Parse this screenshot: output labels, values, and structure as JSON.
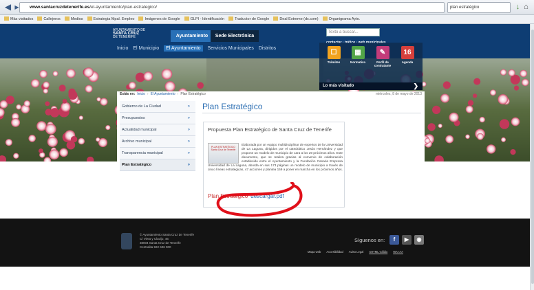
{
  "browser": {
    "url_domain": "www.santacruzdetenerife.es",
    "url_path": "/el-ayuntamiento/plan-estrategico/",
    "search_text": "plan estratégico"
  },
  "bookmarks": [
    "Más visitados",
    "Callejeros",
    "Medios",
    "Estrategia Mpal. Empleo",
    "Imágenes de Google",
    "GLPI - Identificación",
    "Traductor de Google",
    "Deal Extreme (dx.com)",
    "Organigrama Ayto."
  ],
  "site": {
    "logo_line1": "AYUNTAMIENTO DE",
    "logo_line2": "SANTA CRUZ",
    "logo_line3": "DE TENERIFE",
    "tab_ayuntamiento": "Ayuntamiento",
    "tab_sede": "Sede Electrónica",
    "nav": [
      "Inicio",
      "El Municipio",
      "El Ayuntamiento",
      "Servicios Municipales",
      "Distritos"
    ],
    "search_placeholder": "Texto a buscar...",
    "top_links": "contactar  ·  tráfico  ·  web municipales"
  },
  "quick": {
    "items": [
      {
        "label": "Trámites",
        "color": "#f2a31f",
        "glyph": "☐"
      },
      {
        "label": "Normativa",
        "color": "#52a547",
        "glyph": "▦"
      },
      {
        "label": "Perfil de contratante",
        "color": "#c33c7a",
        "glyph": "✎"
      },
      {
        "label": "Agenda",
        "color": "#d6403c",
        "glyph": "16"
      }
    ],
    "mas_visitado": "Lo más visitado"
  },
  "breadcrumb": {
    "prefix": "Estás en:",
    "items": [
      "Inicio",
      "El Ayuntamiento",
      "Plan Estratégico"
    ],
    "date": "miércoles, 8 de mayo de 2013"
  },
  "sidebar": [
    {
      "label": "Gobierno de La Ciudad"
    },
    {
      "label": "Presupuestos"
    },
    {
      "label": "Actualidad municipal"
    },
    {
      "label": "Archivo municipal"
    },
    {
      "label": "Transparencia municipal"
    },
    {
      "label": "Plan Estratégico"
    }
  ],
  "page": {
    "title": "Plan Estratégico",
    "card_title": "Propuesta Plan Estratégico de Santa Cruz de Tenerife",
    "thumb_text": "PLAN ESTRATÉGICO Santa Cruz de Tenerife",
    "description": "Elaborada por un equipo multidisciplinar de expertos de la Universidad de La Laguna, dirigidos por el catedrático Jesús Hernández y que propone un modelo de municipio de cara a los 20 próximos años. Este documento, que se realiza gracias al convenio de colaboración establecido entre el Ayuntamiento y la Fundación Canaria Empresa Universidad de La Laguna, aborda en sus 173 páginas un modelo de municipio a través de cinco líneas estratégicas, 47 acciones y plantea 159 a poner en marcha en los próximos años.",
    "download_label": "Plan Estratégico",
    "download_link": "descargar.pdf"
  },
  "footer": {
    "address": [
      "© Ayuntamiento Santa Cruz de Tenerife",
      "C/ Viera y Clavijo, 46",
      "38004 Santa Cruz de Tenerife",
      "Centralita 922 606 000"
    ],
    "follow": "Síguenos en:",
    "links": [
      "Mapa web",
      "Accesibilidad",
      "Aviso Legal",
      "XHTML Válido",
      "WAI-AA"
    ]
  },
  "colors": {
    "header": "#0e3d73",
    "accent": "#2d6fb3",
    "annotation": "#e0101a"
  }
}
